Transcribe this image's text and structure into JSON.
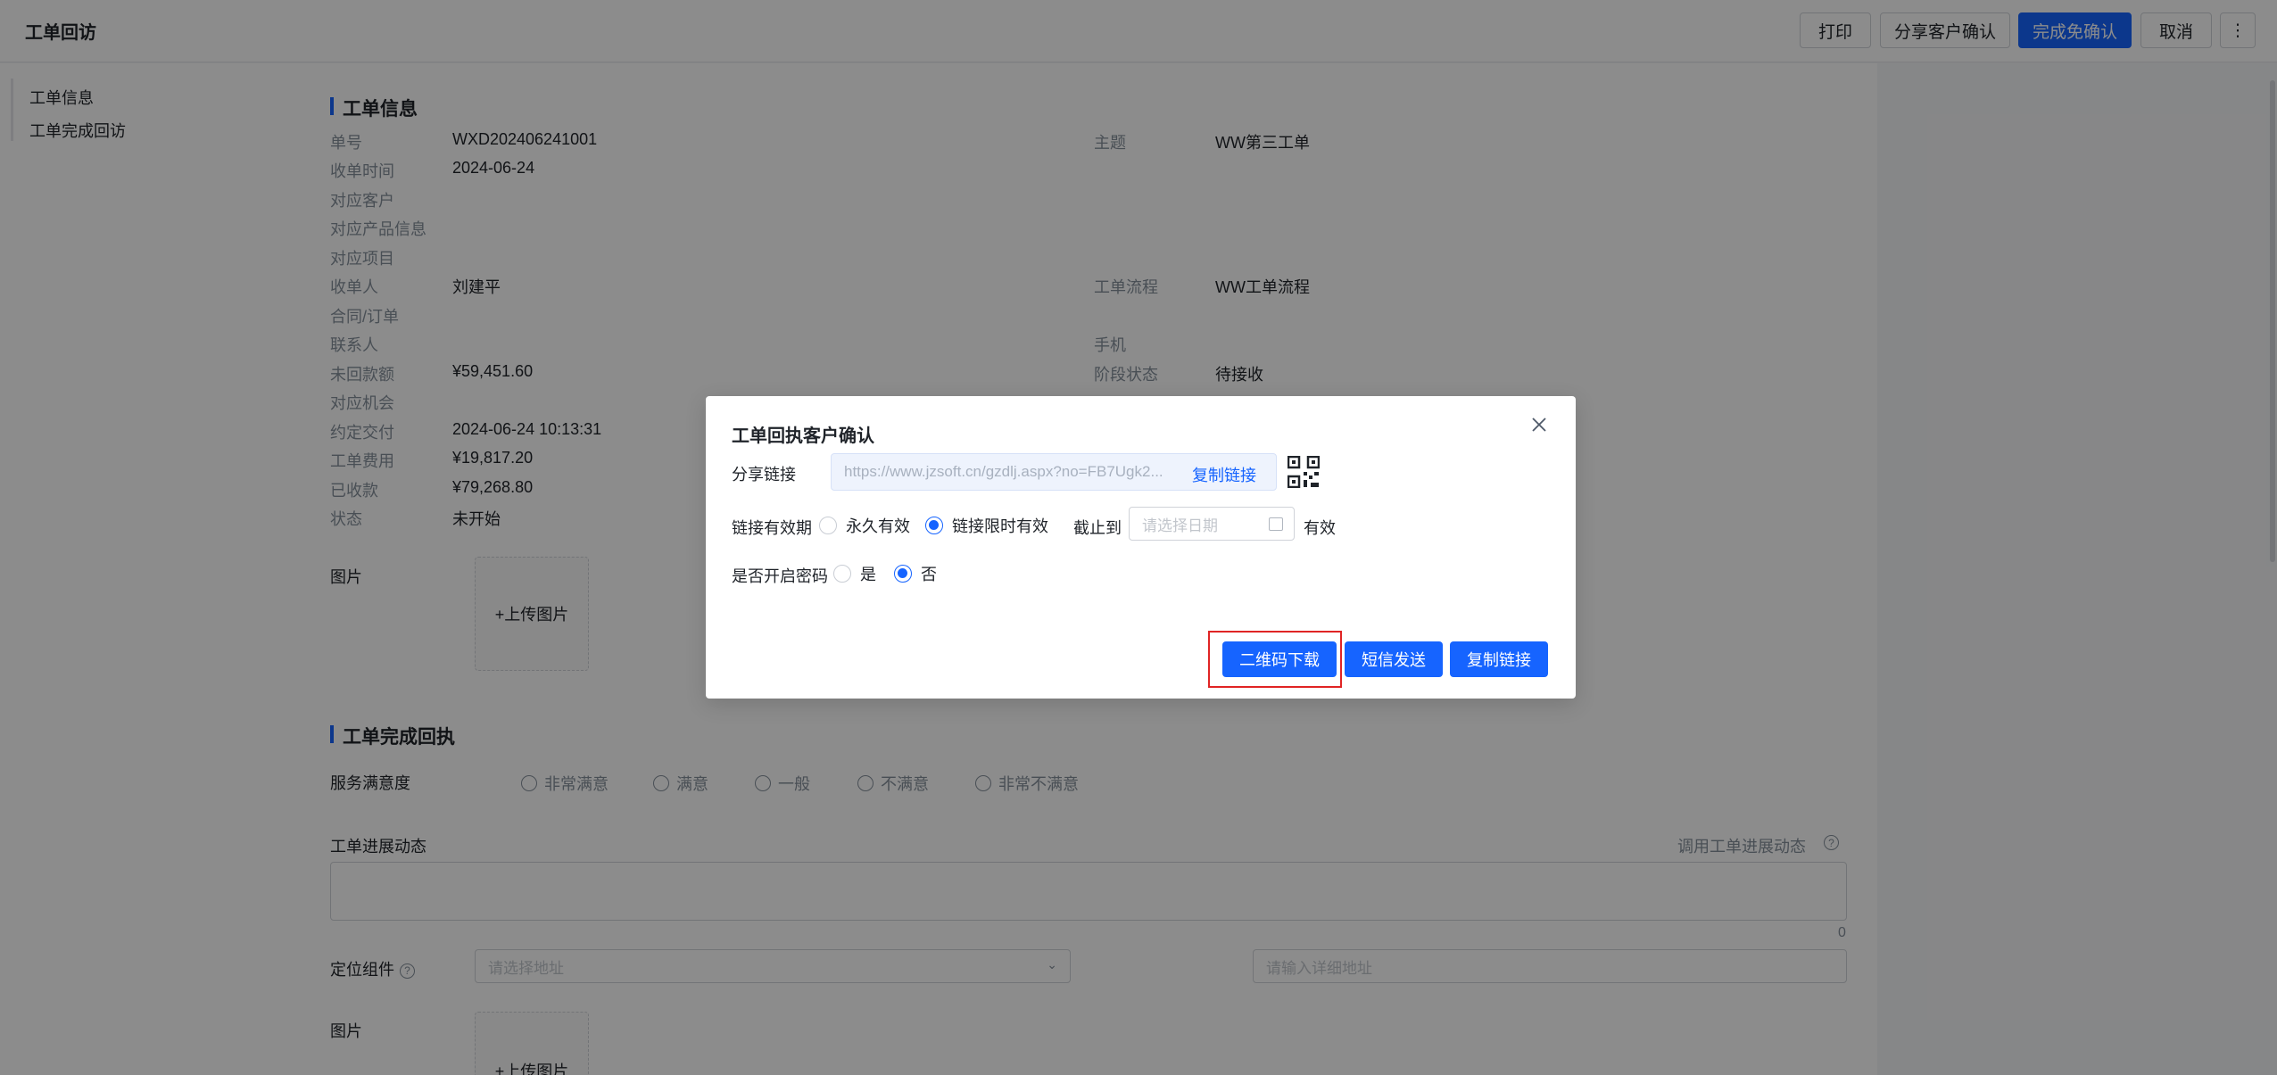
{
  "header": {
    "title": "工单回访",
    "buttons": {
      "print": "打印",
      "share": "分享客户确认",
      "complete": "完成免确认",
      "cancel": "取消",
      "more": "⋮"
    }
  },
  "leftnav": {
    "items": [
      "工单信息",
      "工单完成回访"
    ]
  },
  "section1": {
    "title": "工单信息",
    "left_fields": [
      {
        "label": "单号",
        "value": "WXD202406241001"
      },
      {
        "label": "收单时间",
        "value": "2024-06-24"
      },
      {
        "label": "对应客户",
        "value": ""
      },
      {
        "label": "对应产品信息",
        "value": ""
      },
      {
        "label": "对应项目",
        "value": ""
      },
      {
        "label": "收单人",
        "value": "刘建平"
      },
      {
        "label": "合同/订单",
        "value": ""
      },
      {
        "label": "联系人",
        "value": ""
      },
      {
        "label": "未回款额",
        "value": "¥59,451.60"
      },
      {
        "label": "对应机会",
        "value": ""
      },
      {
        "label": "约定交付",
        "value": "2024-06-24 10:13:31"
      },
      {
        "label": "工单费用",
        "value": "¥19,817.20"
      },
      {
        "label": "已收款",
        "value": "¥79,268.80"
      },
      {
        "label": "状态",
        "value": "未开始"
      }
    ],
    "right_fields": [
      {
        "label": "主题",
        "value": "WW第三工单"
      },
      {
        "label": "工单流程",
        "value": "WW工单流程"
      },
      {
        "label": "手机",
        "value": ""
      },
      {
        "label": "阶段状态",
        "value": "待接收"
      }
    ],
    "image_label": "图片",
    "upload_label": "+上传图片"
  },
  "section2": {
    "title": "工单完成回执",
    "satisfaction_label": "服务满意度",
    "satisfaction_options": [
      "非常满意",
      "满意",
      "一般",
      "不满意",
      "非常不满意"
    ],
    "progress_label": "工单进展动态",
    "progress_link": "调用工单进展动态",
    "char_count": "0",
    "location_label": "定位组件",
    "address_placeholder": "请选择地址",
    "detail_placeholder": "请输入详细地址",
    "image_label": "图片",
    "upload_label": "+上传图片"
  },
  "modal": {
    "title": "工单回执客户确认",
    "share_link_label": "分享链接",
    "share_link_value": "https://www.jzsoft.cn/gzdlj.aspx?no=FB7Ugk2...",
    "copy_inline": "复制链接",
    "validity_label": "链接有效期",
    "validity_options": [
      "永久有效",
      "链接限时有效"
    ],
    "validity_selected": "链接限时有效",
    "until_label": "截止到",
    "date_placeholder": "请选择日期",
    "valid_suffix": "有效",
    "password_label": "是否开启密码",
    "password_options": [
      "是",
      "否"
    ],
    "password_selected": "否",
    "buttons": {
      "qr_download": "二维码下载",
      "sms": "短信发送",
      "copy_link": "复制链接"
    }
  },
  "colors": {
    "primary": "#1664ff",
    "highlight": "#e02424",
    "overlay": "rgba(0,0,0,0.45)"
  }
}
